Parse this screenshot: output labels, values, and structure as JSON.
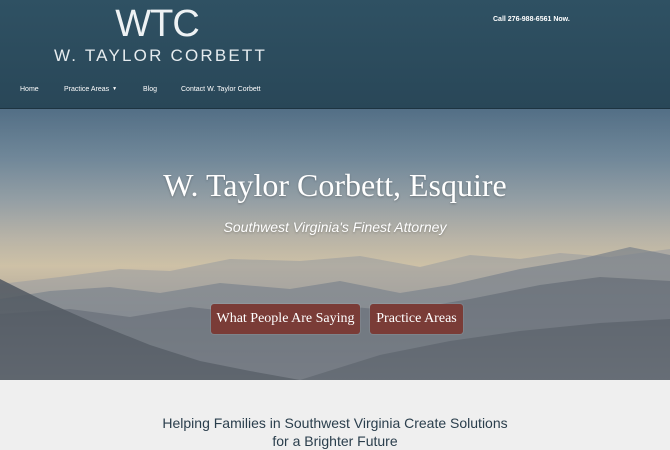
{
  "header": {
    "logo_mark": "WTC",
    "logo_name": "W. TAYLOR CORBETT",
    "call_text": "Call 276-988-6561 Now.",
    "nav": [
      {
        "label": "Home"
      },
      {
        "label": "Practice Areas",
        "dropdown": true
      },
      {
        "label": "Blog"
      },
      {
        "label": "Contact W. Taylor Corbett"
      }
    ]
  },
  "hero": {
    "title": "W. Taylor Corbett, Esquire",
    "subtitle": "Southwest Virginia's Finest Attorney",
    "buttons": [
      {
        "label": "What People Are Saying"
      },
      {
        "label": "Practice Areas"
      }
    ]
  },
  "intro": {
    "line1": "Helping Families in Southwest Virginia Create Solutions",
    "line2": "for a Brighter Future"
  },
  "colors": {
    "header_bg": "#2f5163",
    "button_bg": "#7a3c37",
    "intro_text": "#2a3e4c"
  }
}
